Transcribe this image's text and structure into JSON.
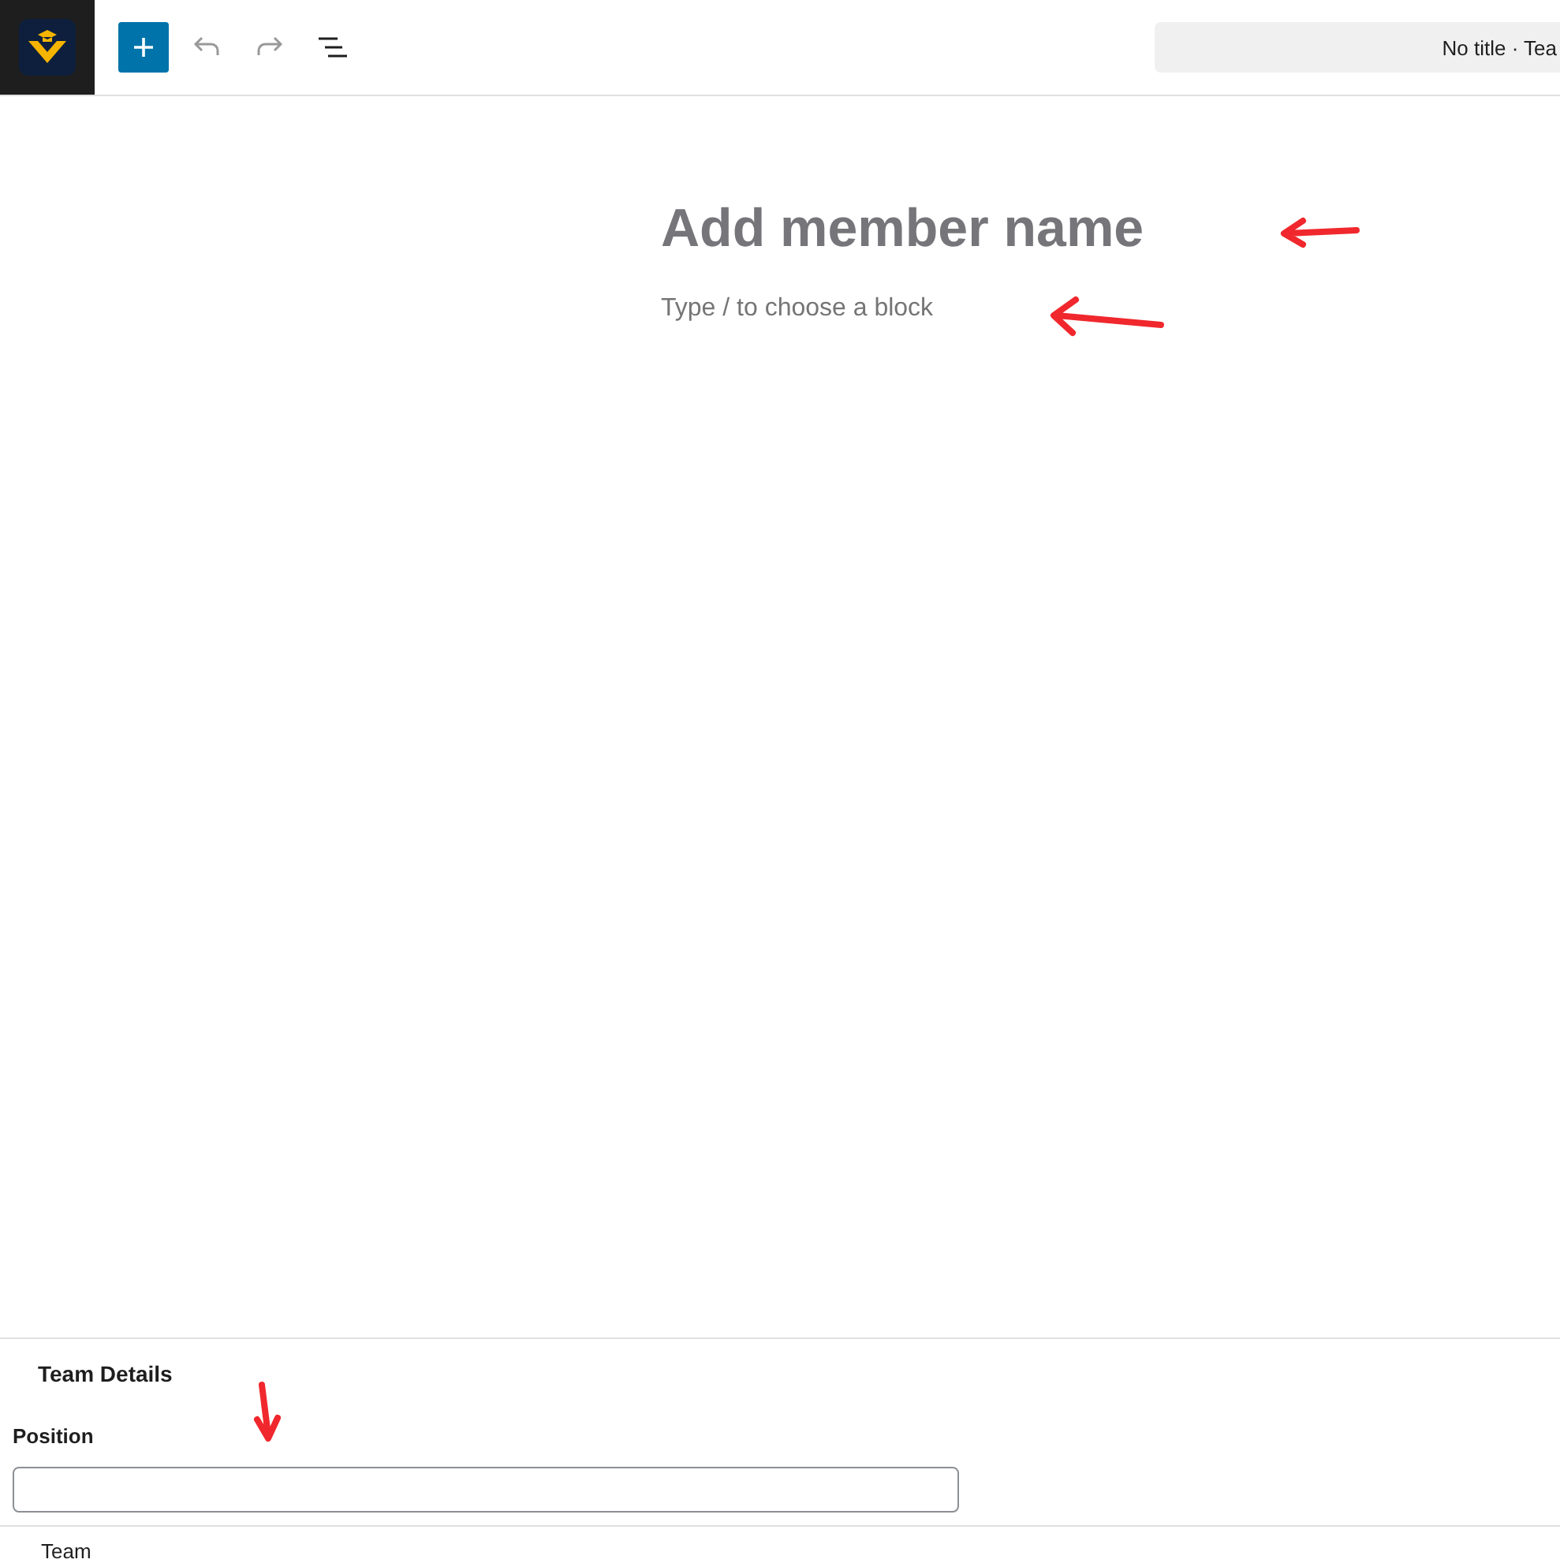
{
  "toolbar": {
    "title_bar": "No title · Tea"
  },
  "editor": {
    "title_placeholder": "Add member name",
    "block_placeholder": "Type / to choose a block"
  },
  "meta_box": {
    "title": "Team Details",
    "fields": [
      {
        "label": "Position"
      }
    ]
  },
  "footer": {
    "label": "Team"
  }
}
